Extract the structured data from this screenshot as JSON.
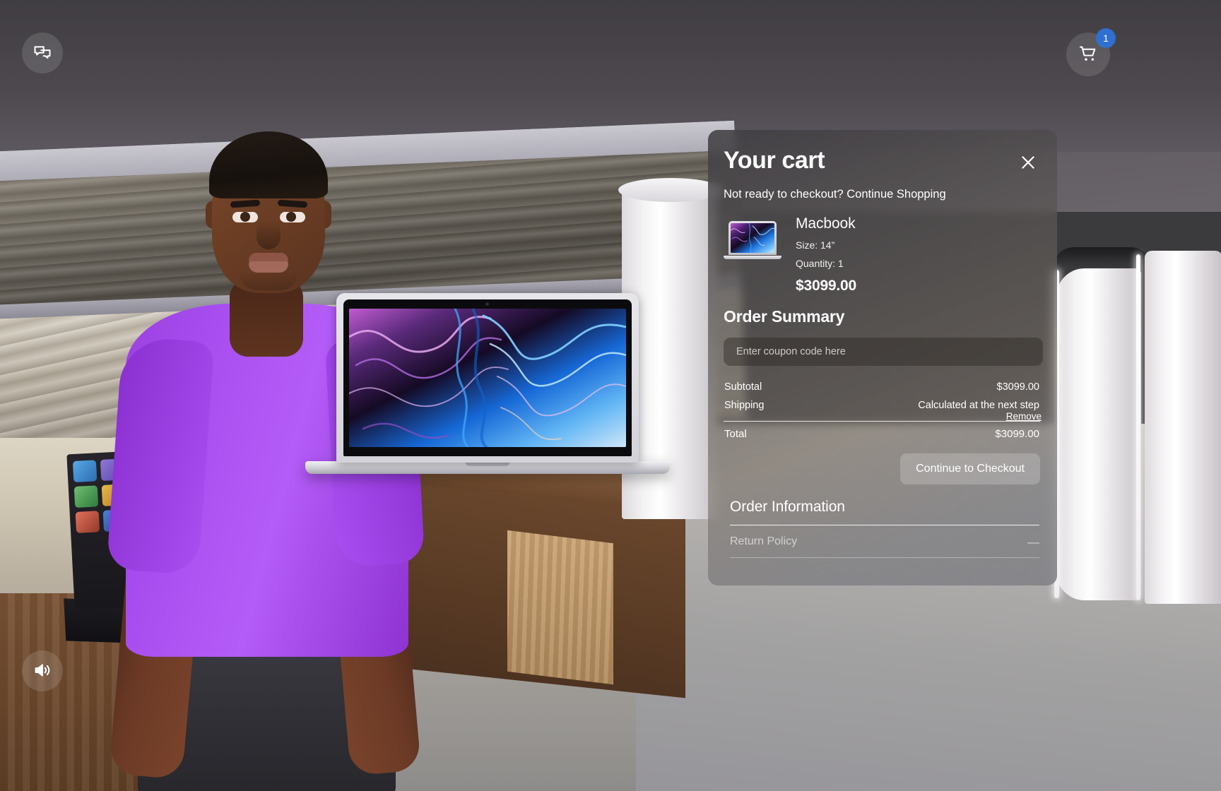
{
  "hud": {
    "chat_button_label": "Chat",
    "chat_icon": "chat-bubbles-icon",
    "sound_button_label": "Sound",
    "sound_icon": "speaker-wave-icon",
    "cart_button_label": "Cart",
    "cart_icon": "shopping-cart-icon",
    "cart_badge_count": "1"
  },
  "cart": {
    "title": "Your cart",
    "close_label": "✕",
    "continue_shopping_text": "Not ready to checkout? Continue Shopping",
    "item": {
      "name": "Macbook",
      "size_label": "Size: 14”",
      "quantity_label": "Quantity: 1",
      "price": "$3099.00",
      "remove_label": "Remove",
      "thumbnail_icon": "macbook-thumbnail"
    },
    "summary": {
      "title": "Order Summary",
      "coupon_placeholder": "Enter coupon code here",
      "coupon_value": "",
      "rows": [
        {
          "label": "Subtotal",
          "value": "$3099.00"
        },
        {
          "label": "Shipping",
          "value": "Calculated at the next step"
        }
      ],
      "total_label": "Total",
      "total_value": "$3099.00",
      "checkout_label": "Continue to Checkout"
    },
    "order_information": {
      "title": "Order Information",
      "sections": [
        {
          "label": "Return Policy",
          "sign": "—"
        }
      ]
    }
  },
  "colors": {
    "accent_badge": "#2f6fd0",
    "panel_text": "#ffffff",
    "avatar_shirt": "#a84ef0"
  }
}
